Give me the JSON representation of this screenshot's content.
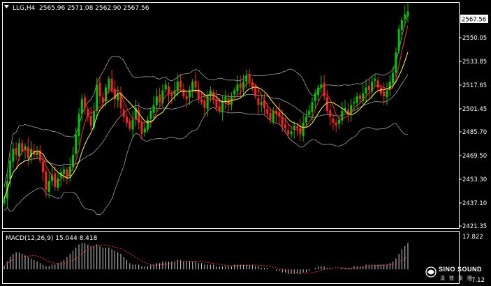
{
  "colors": {
    "background": "#000000",
    "bull": "#00c800",
    "bear": "#ff2020",
    "fast_ma": "#ff3030",
    "slow_ma": "#ffff40",
    "bands": "#a0a0a0",
    "macd_hist": "#d0d0d0",
    "macd_signal": "#ff3030",
    "current_price_box": "#ffffff"
  },
  "header": {
    "menu_icon": "triangle-down-icon",
    "symbol": "LLG,H4",
    "ohlc": "2565.96 2571.08 2562.90 2567.56"
  },
  "price_axis": {
    "ticks": [
      "2550.05",
      "2533.85",
      "2517.65",
      "2501.45",
      "2485.70",
      "2469.50",
      "2453.30",
      "2437.10",
      "2421.35"
    ],
    "current": "2567.56"
  },
  "macd": {
    "label": "MACD(12,26,9) 15.044 8.418",
    "top_tick": "17.822",
    "bottom_tick": "-7.12"
  },
  "logo": {
    "main": "SINO SOUND",
    "sub": "漢聲集團",
    "icon": "sino-sound-logo-icon"
  },
  "chart_data": {
    "type": "candlestick",
    "symbol": "LLG",
    "timeframe": "H4",
    "ylim": [
      2421.35,
      2572
    ],
    "overlays": [
      "bollinger-bands",
      "moving-average-fast",
      "moving-average-slow"
    ],
    "closes": [
      2440,
      2452,
      2466,
      2474,
      2470,
      2478,
      2472,
      2476,
      2468,
      2474,
      2470,
      2472,
      2466,
      2458,
      2446,
      2452,
      2456,
      2448,
      2454,
      2458,
      2460,
      2454,
      2462,
      2470,
      2484,
      2498,
      2508,
      2502,
      2496,
      2490,
      2500,
      2518,
      2510,
      2506,
      2516,
      2522,
      2514,
      2508,
      2512,
      2502,
      2496,
      2492,
      2488,
      2494,
      2502,
      2492,
      2484,
      2488,
      2494,
      2500,
      2504,
      2510,
      2506,
      2514,
      2518,
      2512,
      2510,
      2514,
      2520,
      2516,
      2510,
      2508,
      2514,
      2520,
      2516,
      2508,
      2506,
      2502,
      2510,
      2514,
      2508,
      2502,
      2500,
      2506,
      2510,
      2504,
      2510,
      2514,
      2518,
      2516,
      2520,
      2524,
      2520,
      2516,
      2510,
      2504,
      2506,
      2502,
      2498,
      2494,
      2500,
      2498,
      2496,
      2490,
      2488,
      2484,
      2486,
      2490,
      2488,
      2484,
      2492,
      2496,
      2500,
      2506,
      2512,
      2516,
      2518,
      2510,
      2500,
      2496,
      2492,
      2490,
      2494,
      2500,
      2502,
      2498,
      2504,
      2506,
      2510,
      2508,
      2512,
      2516,
      2514,
      2520,
      2522,
      2516,
      2512,
      2510,
      2514,
      2520,
      2526,
      2540,
      2556,
      2562,
      2566,
      2568
    ],
    "macd_hist": [
      2,
      5,
      8,
      10,
      11,
      11,
      10,
      9,
      8,
      7,
      6,
      5,
      4,
      3,
      2,
      2,
      3,
      3,
      4,
      5,
      6,
      8,
      10,
      12,
      14,
      16,
      17,
      17,
      16,
      15,
      15,
      16,
      15,
      14,
      14,
      14,
      13,
      12,
      11,
      10,
      8,
      6,
      4,
      3,
      3,
      3,
      2,
      2,
      2,
      3,
      3,
      4,
      4,
      5,
      5,
      5,
      5,
      5,
      6,
      6,
      5,
      5,
      5,
      5,
      5,
      4,
      4,
      3,
      3,
      3,
      3,
      2,
      2,
      2,
      2,
      2,
      2,
      3,
      3,
      3,
      3,
      3,
      3,
      3,
      2,
      2,
      1,
      1,
      1,
      0,
      0,
      -1,
      -1,
      -2,
      -2,
      -3,
      -3,
      -3,
      -3,
      -3,
      -2,
      -2,
      -1,
      0,
      1,
      2,
      2,
      2,
      1,
      1,
      0,
      0,
      0,
      1,
      1,
      1,
      1,
      2,
      2,
      2,
      2,
      3,
      3,
      3,
      3,
      3,
      3,
      3,
      3,
      4,
      5,
      7,
      10,
      13,
      15,
      17
    ]
  }
}
